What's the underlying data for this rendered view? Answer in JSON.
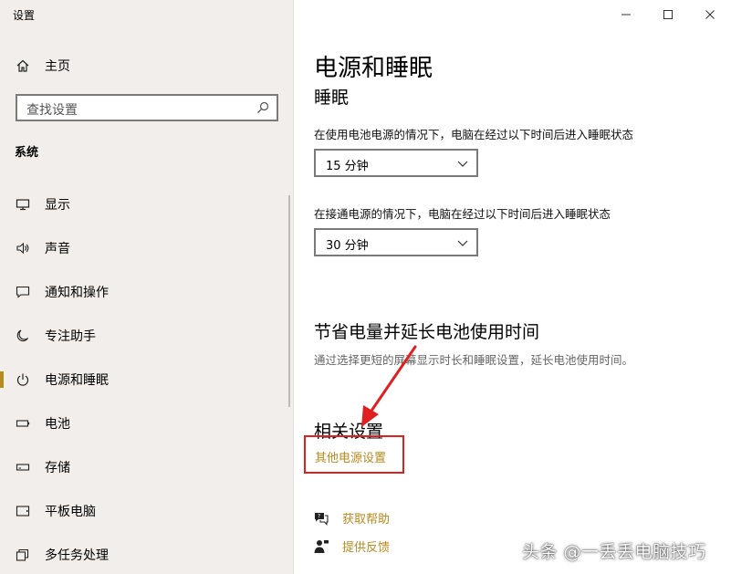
{
  "window": {
    "title": "设置"
  },
  "sidebar": {
    "home_label": "主页",
    "search_placeholder": "查找设置",
    "section_title": "系统",
    "items": [
      {
        "label": "显示",
        "icon": "monitor-icon"
      },
      {
        "label": "声音",
        "icon": "speaker-icon"
      },
      {
        "label": "通知和操作",
        "icon": "message-icon"
      },
      {
        "label": "专注助手",
        "icon": "moon-icon"
      },
      {
        "label": "电源和睡眠",
        "icon": "power-icon",
        "active": true
      },
      {
        "label": "电池",
        "icon": "battery-icon"
      },
      {
        "label": "存储",
        "icon": "storage-icon"
      },
      {
        "label": "平板电脑",
        "icon": "tablet-icon"
      },
      {
        "label": "多任务处理",
        "icon": "multitask-icon"
      }
    ]
  },
  "main": {
    "title": "电源和睡眠",
    "sleep_header": "睡眠",
    "battery_label": "在使用电池电源的情况下，电脑在经过以下时间后进入睡眠状态",
    "battery_value": "15 分钟",
    "plugged_label": "在接通电源的情况下，电脑在经过以下时间后进入睡眠状态",
    "plugged_value": "30 分钟",
    "save_title": "节省电量并延长电池使用时间",
    "save_desc": "通过选择更短的屏幕显示时长和睡眠设置，延长电池使用时间。",
    "related_title": "相关设置",
    "related_link": "其他电源设置",
    "help_link": "获取帮助",
    "feedback_link": "提供反馈"
  },
  "watermark": "头条 @一丢丢电脑技巧",
  "colors": {
    "accent": "#b88a1e",
    "sidebar_bg": "#f1eeeb",
    "annotation": "#e02020"
  }
}
